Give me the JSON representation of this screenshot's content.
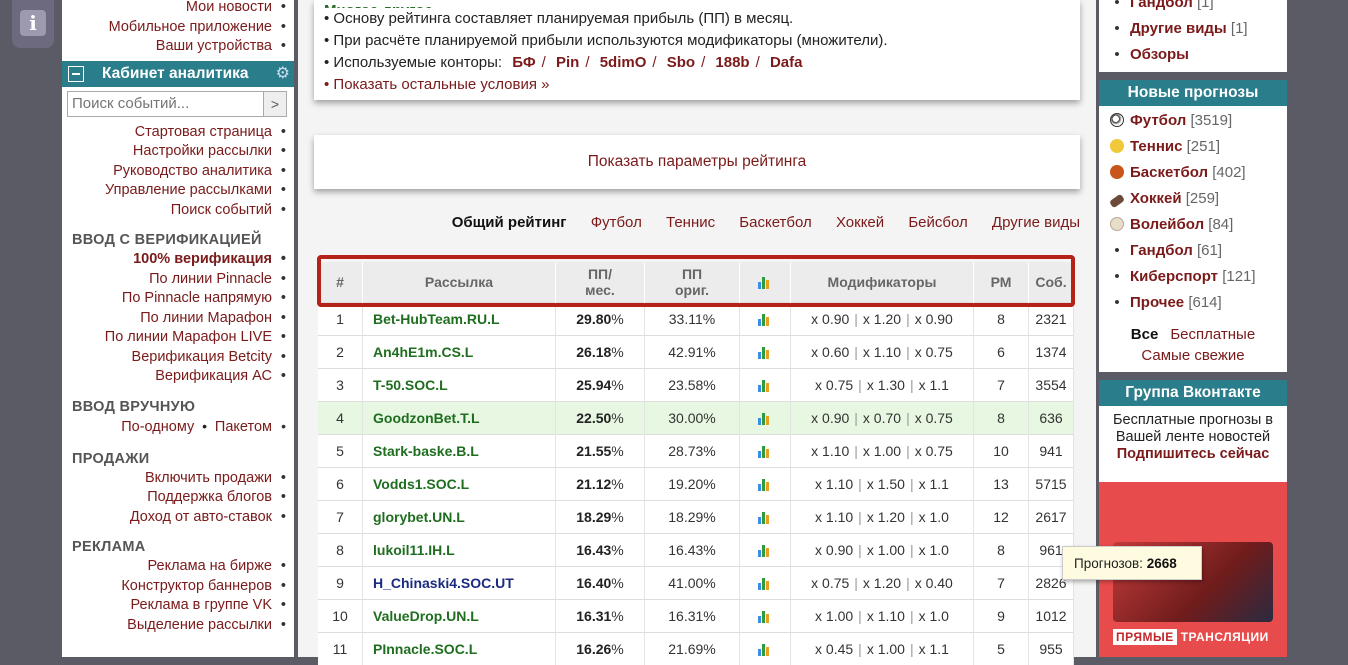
{
  "left": {
    "top_links": [
      "Мои новости",
      "Мобильное приложение",
      "Ваши устройства"
    ],
    "cabinet_title": "Кабинет аналитика",
    "search_placeholder": "Поиск событий...",
    "search_btn": ">",
    "cabinet_links": [
      "Стартовая страница",
      "Настройки рассылки",
      "Руководство аналитика",
      "Управление рассылками",
      "Поиск событий"
    ],
    "sec_verify": "ВВОД С ВЕРИФИКАЦИЕЙ",
    "verify_links": [
      "100% верификация",
      "По линии Pinnacle",
      "По Pinnacle напрямую",
      "По линии Марафон",
      "По линии Марафон LIVE",
      "Верификация Betcity",
      "Верификация АС"
    ],
    "sec_manual": "ВВОД ВРУЧНУЮ",
    "manual_a": "По-одному",
    "manual_b": "Пакетом",
    "sec_sales": "ПРОДАЖИ",
    "sales_links": [
      "Включить продажи",
      "Поддержка блогов",
      "Доход от авто-ставок"
    ],
    "sec_ads": "РЕКЛАМА",
    "ads_links": [
      "Реклама на бирже",
      "Конструктор баннеров",
      "Реклама в группе VK",
      "Выделение рассылки"
    ]
  },
  "info": {
    "cut_line": "Многое другое.",
    "line1": "• Основу рейтинга составляет планируемая прибыль (ПП) в месяц.",
    "line2": "• При расчёте планируемой прибыли используются модификаторы (множители).",
    "line3_prefix": "• Используемые конторы:",
    "bookmakers": [
      "БФ",
      "Pin",
      "5dimO",
      "Sbo",
      "188b",
      "Dafa"
    ],
    "line4": "• Показать остальные условия »"
  },
  "show_params": "Показать параметры рейтинга",
  "tabs": [
    "Общий рейтинг",
    "Футбол",
    "Теннис",
    "Баскетбол",
    "Хоккей",
    "Бейсбол",
    "Другие виды"
  ],
  "table": {
    "headers": {
      "num": "#",
      "name": "Рассылка",
      "pp1": "ПП/",
      "pp2": "мес.",
      "orig1": "ПП",
      "orig2": "ориг.",
      "mods": "Модификаторы",
      "rm": "РМ",
      "events": "Соб."
    },
    "rows": [
      {
        "n": "1",
        "name": "Bet-HubTeam.RU.L",
        "pp": "29.80",
        "orig": "33.11%",
        "m1": "x 0.90",
        "m2": "x 1.20",
        "m3": "x 0.90",
        "rm": "8",
        "ev": "2321"
      },
      {
        "n": "2",
        "name": "An4hE1m.CS.L",
        "pp": "26.18",
        "orig": "42.91%",
        "m1": "x 0.60",
        "m2": "x 1.10",
        "m3": "x 0.75",
        "rm": "6",
        "ev": "1374"
      },
      {
        "n": "3",
        "name": "T-50.SOC.L",
        "pp": "25.94",
        "orig": "23.58%",
        "m1": "x 0.75",
        "m2": "x 1.30",
        "m3": "x 1.1",
        "rm": "7",
        "ev": "3554"
      },
      {
        "n": "4",
        "name": "GoodzonBet.T.L",
        "pp": "22.50",
        "orig": "30.00%",
        "m1": "x 0.90",
        "m2": "x 0.70",
        "m3": "x 0.75",
        "rm": "8",
        "ev": "636"
      },
      {
        "n": "5",
        "name": "Stark-baske.B.L",
        "pp": "21.55",
        "orig": "28.73%",
        "m1": "x 1.10",
        "m2": "x 1.00",
        "m3": "x 0.75",
        "rm": "10",
        "ev": "941"
      },
      {
        "n": "6",
        "name": "Vodds1.SOC.L",
        "pp": "21.12",
        "orig": "19.20%",
        "m1": "x 1.10",
        "m2": "x 1.50",
        "m3": "x 1.1",
        "rm": "13",
        "ev": "5715"
      },
      {
        "n": "7",
        "name": "glorybet.UN.L",
        "pp": "18.29",
        "orig": "18.29%",
        "m1": "x 1.10",
        "m2": "x 1.20",
        "m3": "x 1.0",
        "rm": "12",
        "ev": "2617"
      },
      {
        "n": "8",
        "name": "lukoil11.IH.L",
        "pp": "16.43",
        "orig": "16.43%",
        "m1": "x 0.90",
        "m2": "x 1.00",
        "m3": "x 1.0",
        "rm": "8",
        "ev": "961"
      },
      {
        "n": "9",
        "name": "H_Chinaski4.SOC.UT",
        "pp": "16.40",
        "orig": "41.00%",
        "m1": "x 0.75",
        "m2": "x 1.20",
        "m3": "x 0.40",
        "rm": "7",
        "ev": "2826"
      },
      {
        "n": "10",
        "name": "ValueDrop.UN.L",
        "pp": "16.31",
        "orig": "16.31%",
        "m1": "x 1.00",
        "m2": "x 1.10",
        "m3": "x 1.0",
        "rm": "9",
        "ev": "1012"
      },
      {
        "n": "11",
        "name": "PInnacle.SOC.L",
        "pp": "16.26",
        "orig": "21.69%",
        "m1": "x 0.45",
        "m2": "x 1.00",
        "m3": "x 1.1",
        "rm": "5",
        "ev": "955"
      }
    ]
  },
  "right": {
    "top_items": [
      {
        "label": "Гандбол",
        "count": "[1]"
      },
      {
        "label": "Другие виды",
        "count": "[1]"
      },
      {
        "label": "Обзоры",
        "count": ""
      }
    ],
    "new_title": "Новые прогнозы",
    "sports": [
      {
        "label": "Футбол",
        "count": "[3519]"
      },
      {
        "label": "Теннис",
        "count": "[251]"
      },
      {
        "label": "Баскетбол",
        "count": "[402]"
      },
      {
        "label": "Хоккей",
        "count": "[259]"
      },
      {
        "label": "Волейбол",
        "count": "[84]"
      },
      {
        "label": "Гандбол",
        "count": "[61]"
      },
      {
        "label": "Киберспорт",
        "count": "[121]"
      },
      {
        "label": "Прочее",
        "count": "[614]"
      }
    ],
    "filter_all": "Все",
    "filter_free": "Бесплатные",
    "filter_fresh": "Самые свежие",
    "vk_title": "Группа Вконтакте",
    "vk_text": "Бесплатные прогнозы в Вашей ленте новостей",
    "vk_sub": "Подпишитесь сейчас",
    "banner_live": "ПРЯМЫЕ",
    "banner_text": "ТРАНСЛЯЦИИ"
  },
  "tooltip": {
    "label": "Прогнозов:",
    "value": "2668"
  }
}
